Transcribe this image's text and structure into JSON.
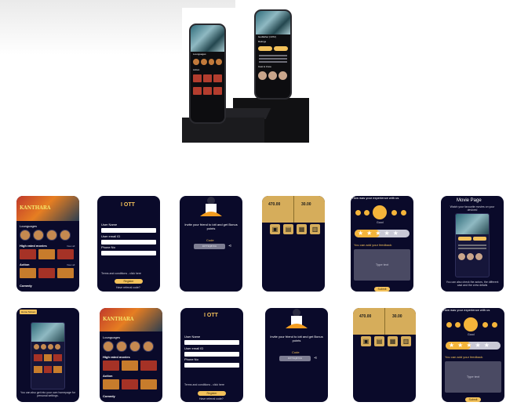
{
  "hero": {
    "phone_left": {
      "sections": [
        "Lounguages",
        "Action"
      ]
    },
    "phone_right": {
      "title": "Godfather (1972)",
      "subtitle": "Ratings",
      "buttons": [
        "Play Now",
        "Watch Trailer"
      ],
      "cast_label": "Cast & Crew"
    }
  },
  "home": {
    "poster_title": "KANTHARA",
    "sections": {
      "languages": "Lounguages",
      "high_rated": "High rated movies",
      "action": "Action",
      "comedy": "Comedy"
    },
    "view_all": "View all"
  },
  "register": {
    "brand": "I OTT",
    "fields": [
      "User Name",
      "User email ID",
      "Phone No"
    ],
    "terms": "Terms and conditions - click here",
    "button": "Register",
    "referral": "Have referral code?"
  },
  "invite": {
    "headline": "Invite your friend to iott and get Bonus points",
    "code_label": "Code",
    "code_value": "IOTT3Q87XU"
  },
  "wallet": {
    "left_value": "470.00",
    "right_value": "30.00",
    "icons": [
      "gift-icon",
      "card-icon",
      "coupon-icon",
      "wallet-icon"
    ]
  },
  "feedback": {
    "question": "How was your experience with us",
    "faces": [
      "Very bad",
      "Bad",
      "Good",
      "Nice",
      "Superb"
    ],
    "selected": "Good",
    "rating_fraction": 0.45,
    "feedback_label": "You can add your feedback",
    "placeholder": "Type text",
    "submit": "Submit"
  },
  "movie_page": {
    "title": "Movie Page",
    "caption": "Watch your favourite movies on your devices!",
    "footer": "You can also check the actors, the different cast and the crew details"
  },
  "home_screen": {
    "tag": "Home Screen",
    "caption": "You can also get into your own homepage for personal settings."
  },
  "colors": {
    "screen_bg": "#0a0a2a",
    "accent": "#f3c15a",
    "wallet_gold": "#d6ad5b"
  }
}
